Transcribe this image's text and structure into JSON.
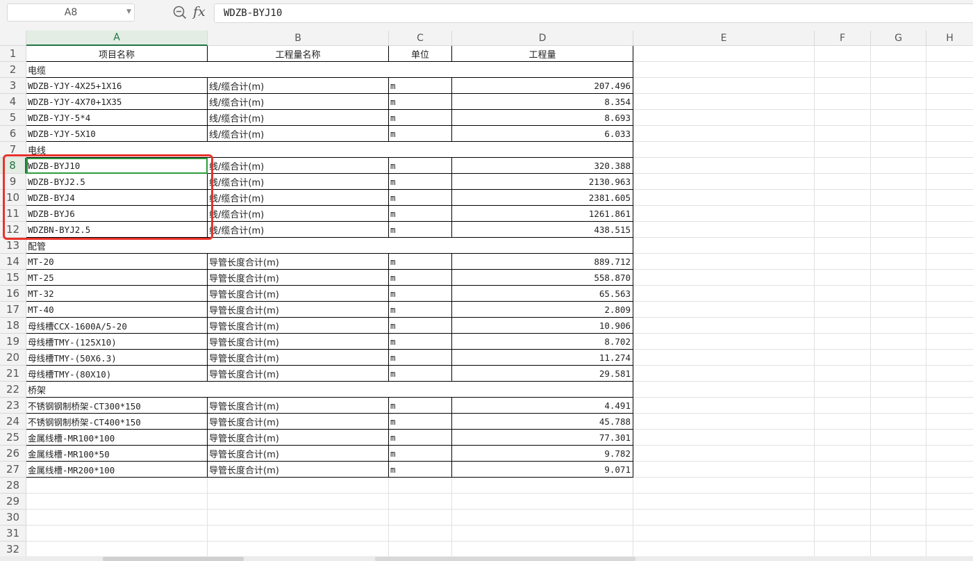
{
  "formula_bar": {
    "cell_ref": "A8",
    "fx_label": "fx",
    "formula_value": "WDZB-BYJ10"
  },
  "columns": [
    "A",
    "B",
    "C",
    "D",
    "E",
    "F",
    "G",
    "H"
  ],
  "selected_column": "A",
  "selected_row": 8,
  "rows": [
    {
      "n": "1",
      "a": "项目名称",
      "b": "工程量名称",
      "c": "单位",
      "d": "工程量",
      "type": "header"
    },
    {
      "n": "2",
      "a": "电缆",
      "b": "",
      "c": "",
      "d": "",
      "type": "section"
    },
    {
      "n": "3",
      "a": "WDZB-YJY-4X25+1X16",
      "b": "线/缆合计(m)",
      "c": "m",
      "d": "207.496",
      "type": "data"
    },
    {
      "n": "4",
      "a": "WDZB-YJY-4X70+1X35",
      "b": "线/缆合计(m)",
      "c": "m",
      "d": "8.354",
      "type": "data"
    },
    {
      "n": "5",
      "a": "WDZB-YJY-5*4",
      "b": "线/缆合计(m)",
      "c": "m",
      "d": "8.693",
      "type": "data"
    },
    {
      "n": "6",
      "a": "WDZB-YJY-5X10",
      "b": "线/缆合计(m)",
      "c": "m",
      "d": "6.033",
      "type": "data"
    },
    {
      "n": "7",
      "a": "电线",
      "b": "",
      "c": "",
      "d": "",
      "type": "section"
    },
    {
      "n": "8",
      "a": "WDZB-BYJ10",
      "b": "线/缆合计(m)",
      "c": "m",
      "d": "320.388",
      "type": "data"
    },
    {
      "n": "9",
      "a": "WDZB-BYJ2.5",
      "b": "线/缆合计(m)",
      "c": "m",
      "d": "2130.963",
      "type": "data"
    },
    {
      "n": "10",
      "a": "WDZB-BYJ4",
      "b": "线/缆合计(m)",
      "c": "m",
      "d": "2381.605",
      "type": "data"
    },
    {
      "n": "11",
      "a": "WDZB-BYJ6",
      "b": "线/缆合计(m)",
      "c": "m",
      "d": "1261.861",
      "type": "data"
    },
    {
      "n": "12",
      "a": "WDZBN-BYJ2.5",
      "b": "线/缆合计(m)",
      "c": "m",
      "d": "438.515",
      "type": "data"
    },
    {
      "n": "13",
      "a": "配管",
      "b": "",
      "c": "",
      "d": "",
      "type": "section"
    },
    {
      "n": "14",
      "a": "MT-20",
      "b": "导管长度合计(m)",
      "c": "m",
      "d": "889.712",
      "type": "data"
    },
    {
      "n": "15",
      "a": "MT-25",
      "b": "导管长度合计(m)",
      "c": "m",
      "d": "558.870",
      "type": "data"
    },
    {
      "n": "16",
      "a": "MT-32",
      "b": "导管长度合计(m)",
      "c": "m",
      "d": "65.563",
      "type": "data"
    },
    {
      "n": "17",
      "a": "MT-40",
      "b": "导管长度合计(m)",
      "c": "m",
      "d": "2.809",
      "type": "data"
    },
    {
      "n": "18",
      "a": "母线槽CCX-1600A/5-20",
      "b": "导管长度合计(m)",
      "c": "m",
      "d": "10.906",
      "type": "data"
    },
    {
      "n": "19",
      "a": "母线槽TMY-(125X10)",
      "b": "导管长度合计(m)",
      "c": "m",
      "d": "8.702",
      "type": "data"
    },
    {
      "n": "20",
      "a": "母线槽TMY-(50X6.3)",
      "b": "导管长度合计(m)",
      "c": "m",
      "d": "11.274",
      "type": "data"
    },
    {
      "n": "21",
      "a": "母线槽TMY-(80X10)",
      "b": "导管长度合计(m)",
      "c": "m",
      "d": "29.581",
      "type": "data"
    },
    {
      "n": "22",
      "a": "桥架",
      "b": "",
      "c": "",
      "d": "",
      "type": "section"
    },
    {
      "n": "23",
      "a": "不锈钢钢制桥架-CT300*150",
      "b": "导管长度合计(m)",
      "c": "m",
      "d": "4.491",
      "type": "data"
    },
    {
      "n": "24",
      "a": "不锈钢钢制桥架-CT400*150",
      "b": "导管长度合计(m)",
      "c": "m",
      "d": "45.788",
      "type": "data"
    },
    {
      "n": "25",
      "a": "金属线槽-MR100*100",
      "b": "导管长度合计(m)",
      "c": "m",
      "d": "77.301",
      "type": "data"
    },
    {
      "n": "26",
      "a": "金属线槽-MR100*50",
      "b": "导管长度合计(m)",
      "c": "m",
      "d": "9.782",
      "type": "data"
    },
    {
      "n": "27",
      "a": "金属线槽-MR200*100",
      "b": "导管长度合计(m)",
      "c": "m",
      "d": "9.071",
      "type": "data"
    },
    {
      "n": "28",
      "a": "",
      "b": "",
      "c": "",
      "d": "",
      "type": "empty"
    },
    {
      "n": "29",
      "a": "",
      "b": "",
      "c": "",
      "d": "",
      "type": "empty"
    },
    {
      "n": "30",
      "a": "",
      "b": "",
      "c": "",
      "d": "",
      "type": "empty"
    },
    {
      "n": "31",
      "a": "",
      "b": "",
      "c": "",
      "d": "",
      "type": "empty"
    },
    {
      "n": "32",
      "a": "",
      "b": "",
      "c": "",
      "d": "",
      "type": "empty"
    }
  ],
  "colors": {
    "selection_green": "#217346",
    "highlight_red": "#e8332b"
  }
}
